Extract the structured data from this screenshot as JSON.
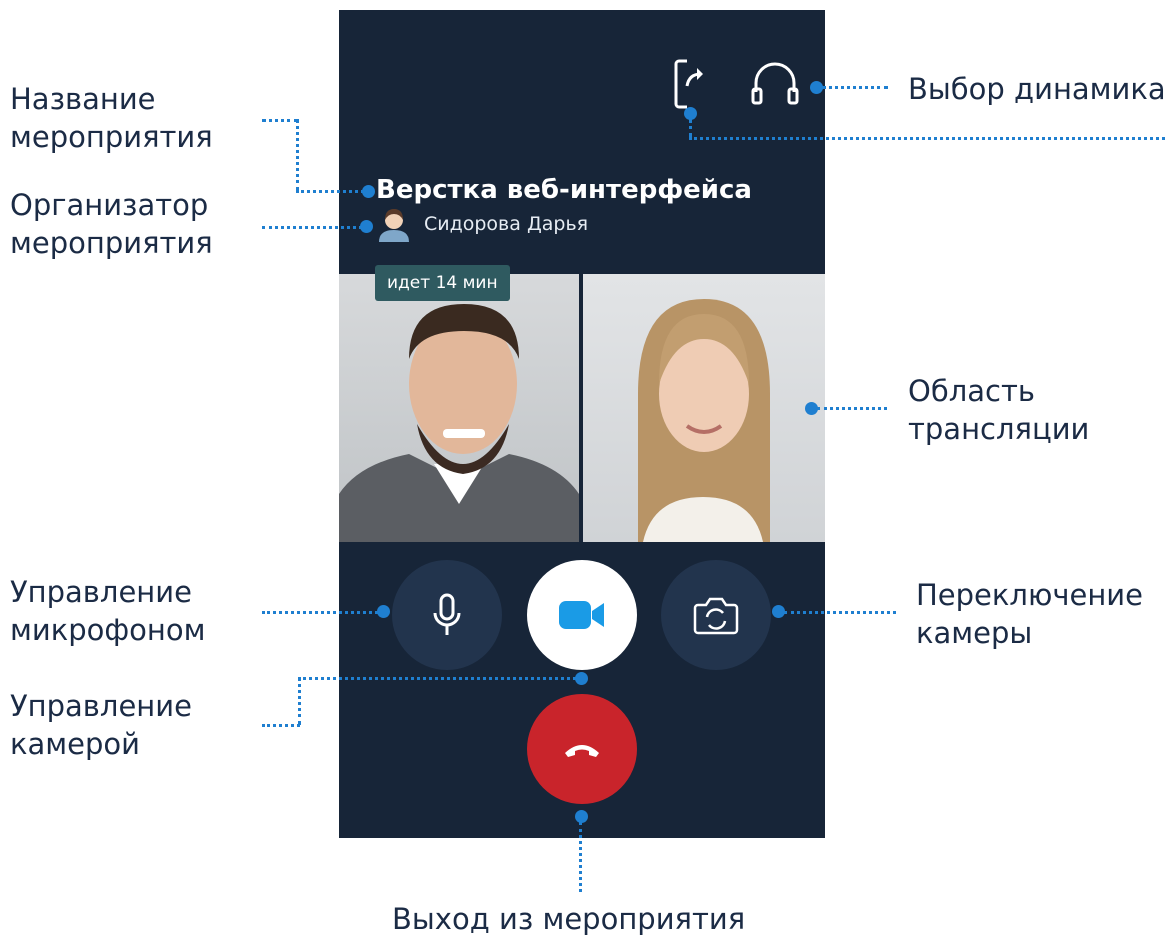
{
  "callouts": {
    "event_name": {
      "line1": "Название",
      "line2": "мероприятия"
    },
    "organizer": {
      "line1": "Организатор",
      "line2": "мероприятия"
    },
    "speaker": {
      "line1": "Выбор динамика"
    },
    "broadcast_area": {
      "line1": "Область",
      "line2": "трансляции"
    },
    "mic_control": {
      "line1": "Управление",
      "line2": "микрофоном"
    },
    "camera_control": {
      "line1": "Управление",
      "line2": "камерой"
    },
    "switch_camera": {
      "line1": "Переключение",
      "line2": "камеры"
    },
    "exit": {
      "line1": "Выход из мероприятия"
    }
  },
  "call": {
    "title": "Верстка веб-интерфейса",
    "organizer_name": "Сидорова Дарья",
    "timer": "идет 14 мин"
  },
  "icons": {
    "share": "share-screen-icon",
    "speaker": "headphones-icon",
    "mic": "microphone-icon",
    "camera": "video-camera-icon",
    "switch": "switch-camera-icon",
    "hangup": "hang-up-icon"
  },
  "colors": {
    "background": "#172538",
    "accent": "#1f7fd0",
    "hangup": "#c9242b",
    "camera_icon": "#1a9be6"
  }
}
